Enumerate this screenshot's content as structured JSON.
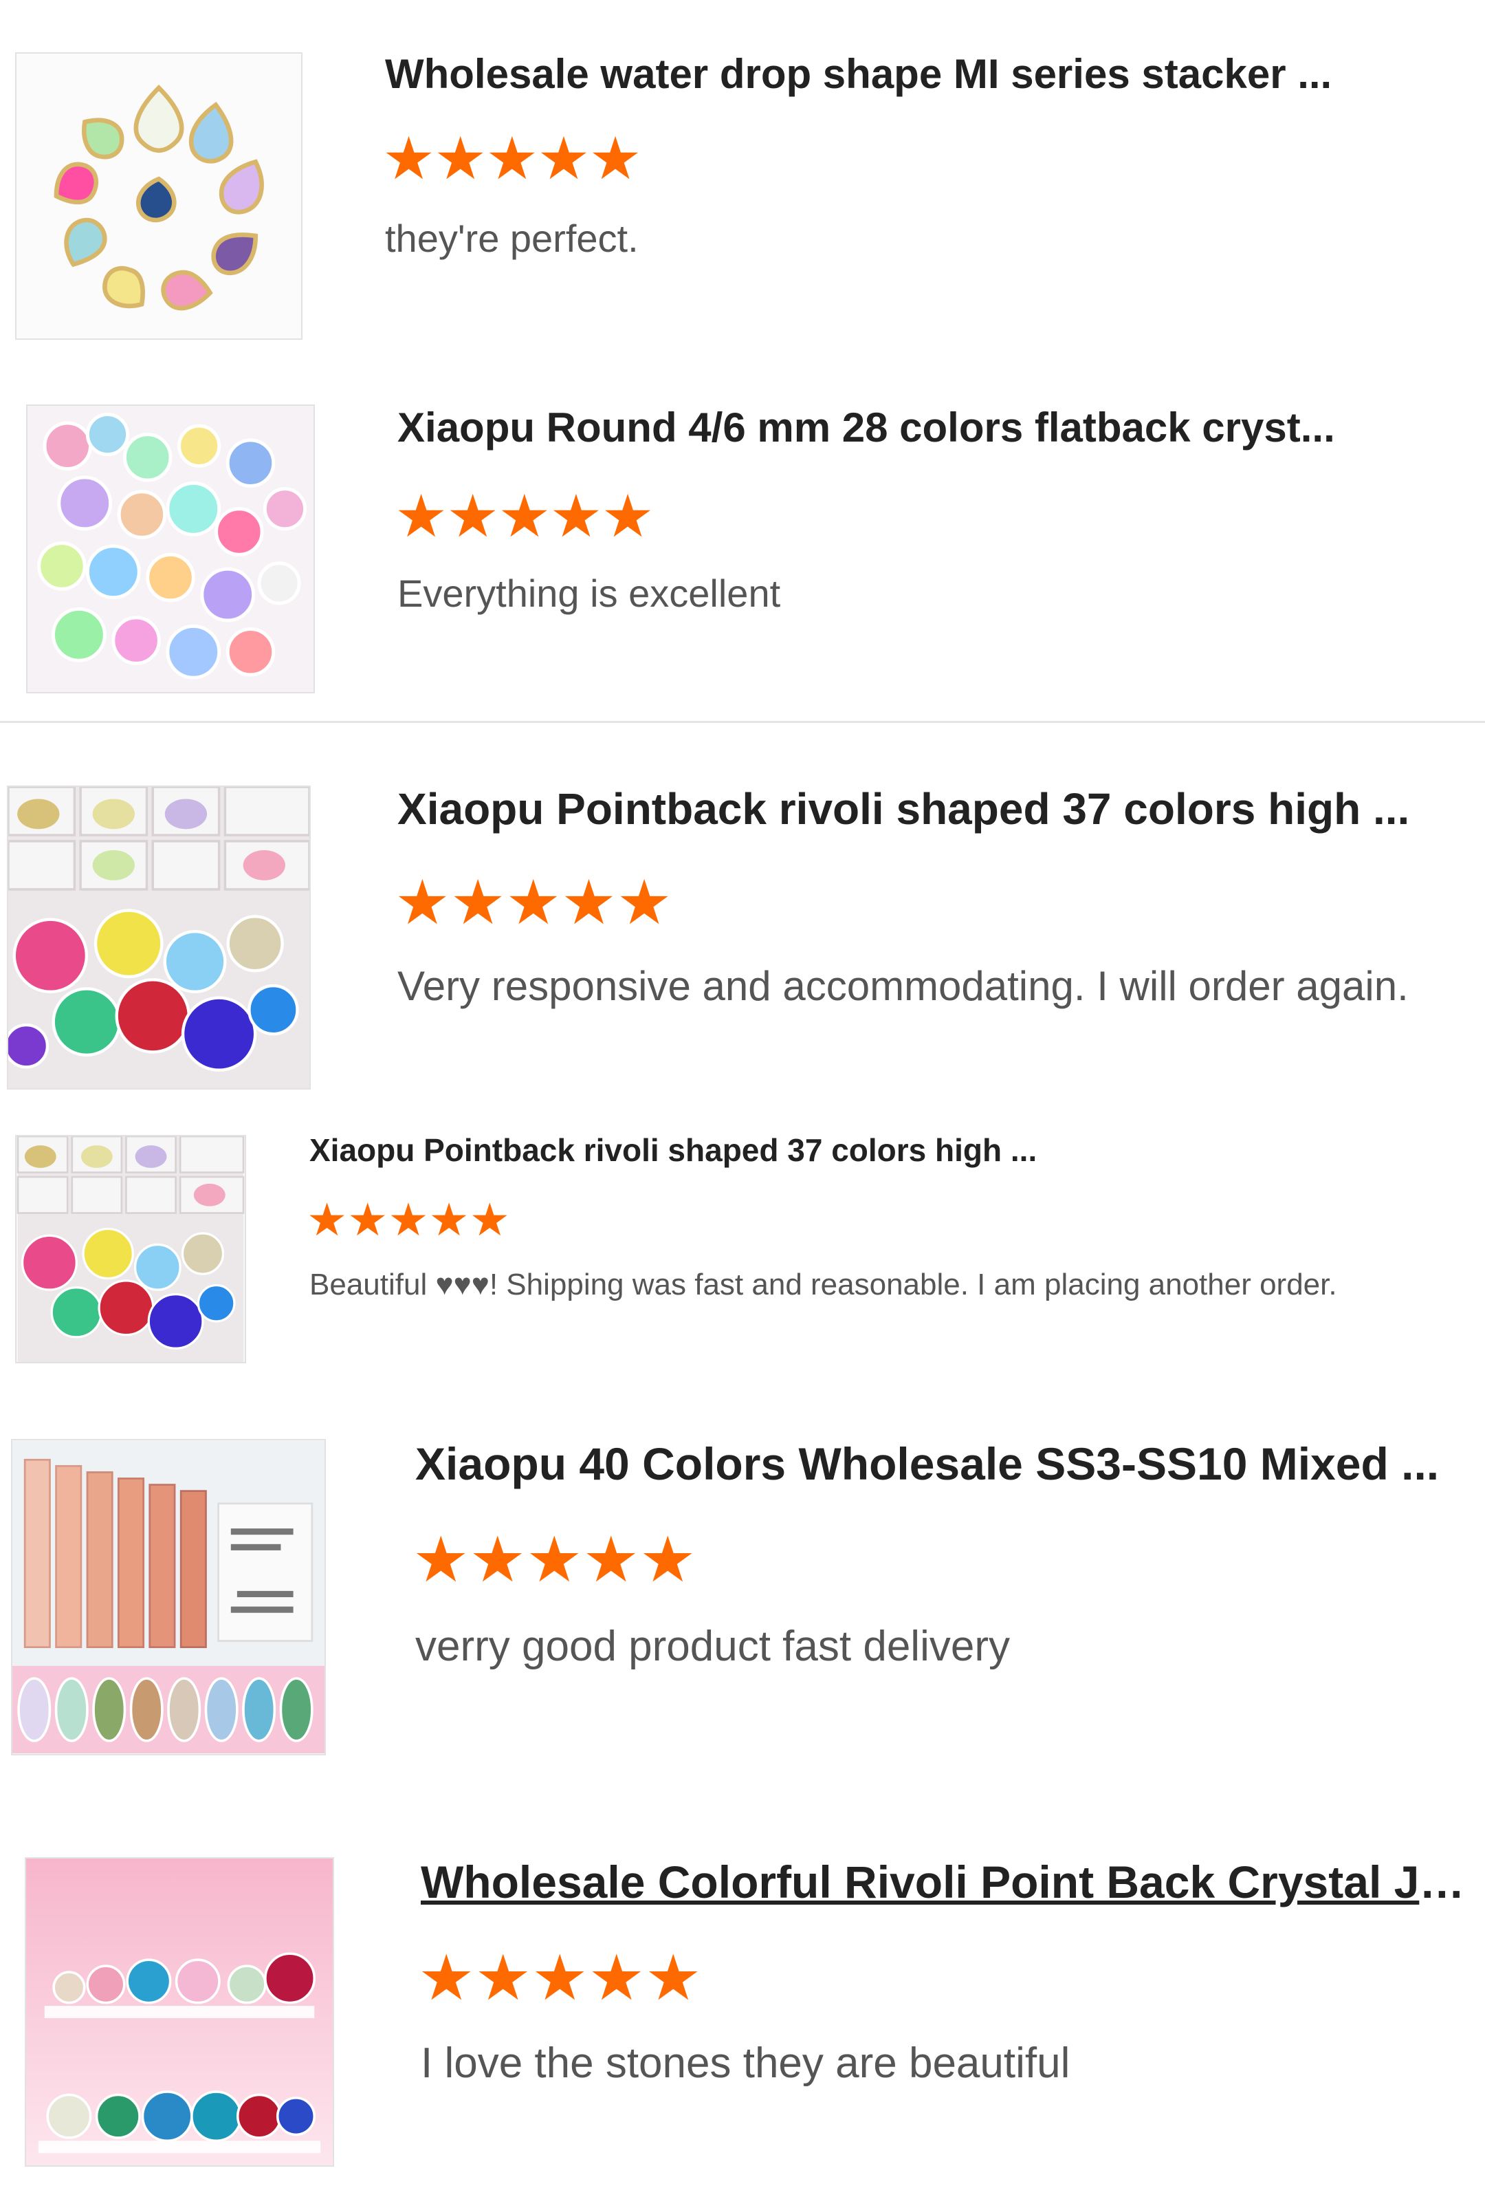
{
  "reviews": [
    {
      "title": "Wholesale water drop shape MI series stacker ...",
      "rating": 5,
      "comment": "they're perfect.",
      "thumbnail_icon": "teardrop-rhinestones-image"
    },
    {
      "title": "Xiaopu Round 4/6 mm 28 colors flatback cryst...",
      "rating": 5,
      "comment": "Everything is excellent",
      "thumbnail_icon": "round-flatback-crystals-image"
    },
    {
      "title": "Xiaopu Pointback rivoli shaped 37 colors high ...",
      "rating": 5,
      "comment": "Very responsive and accommodating. I will order again.",
      "thumbnail_icon": "rivoli-pointback-crystals-image"
    },
    {
      "title": "Xiaopu Pointback rivoli shaped 37 colors high ...",
      "rating": 5,
      "comment": "Beautiful ♥♥♥!  Shipping was fast and reasonable.  I am placing another order.",
      "thumbnail_icon": "rivoli-pointback-crystals-image"
    },
    {
      "title": "Xiaopu 40 Colors Wholesale SS3-SS10 Mixed ...",
      "rating": 5,
      "comment": "verry good product fast delivery",
      "thumbnail_icon": "mixed-rhinestone-box-image"
    },
    {
      "title": "Wholesale Colorful Rivoli Point Back Crystal Je...",
      "rating": 5,
      "comment": "I love the stones they are beautiful",
      "thumbnail_icon": "rivoli-stones-on-shelf-image"
    }
  ],
  "star_color": "#ff6a00"
}
